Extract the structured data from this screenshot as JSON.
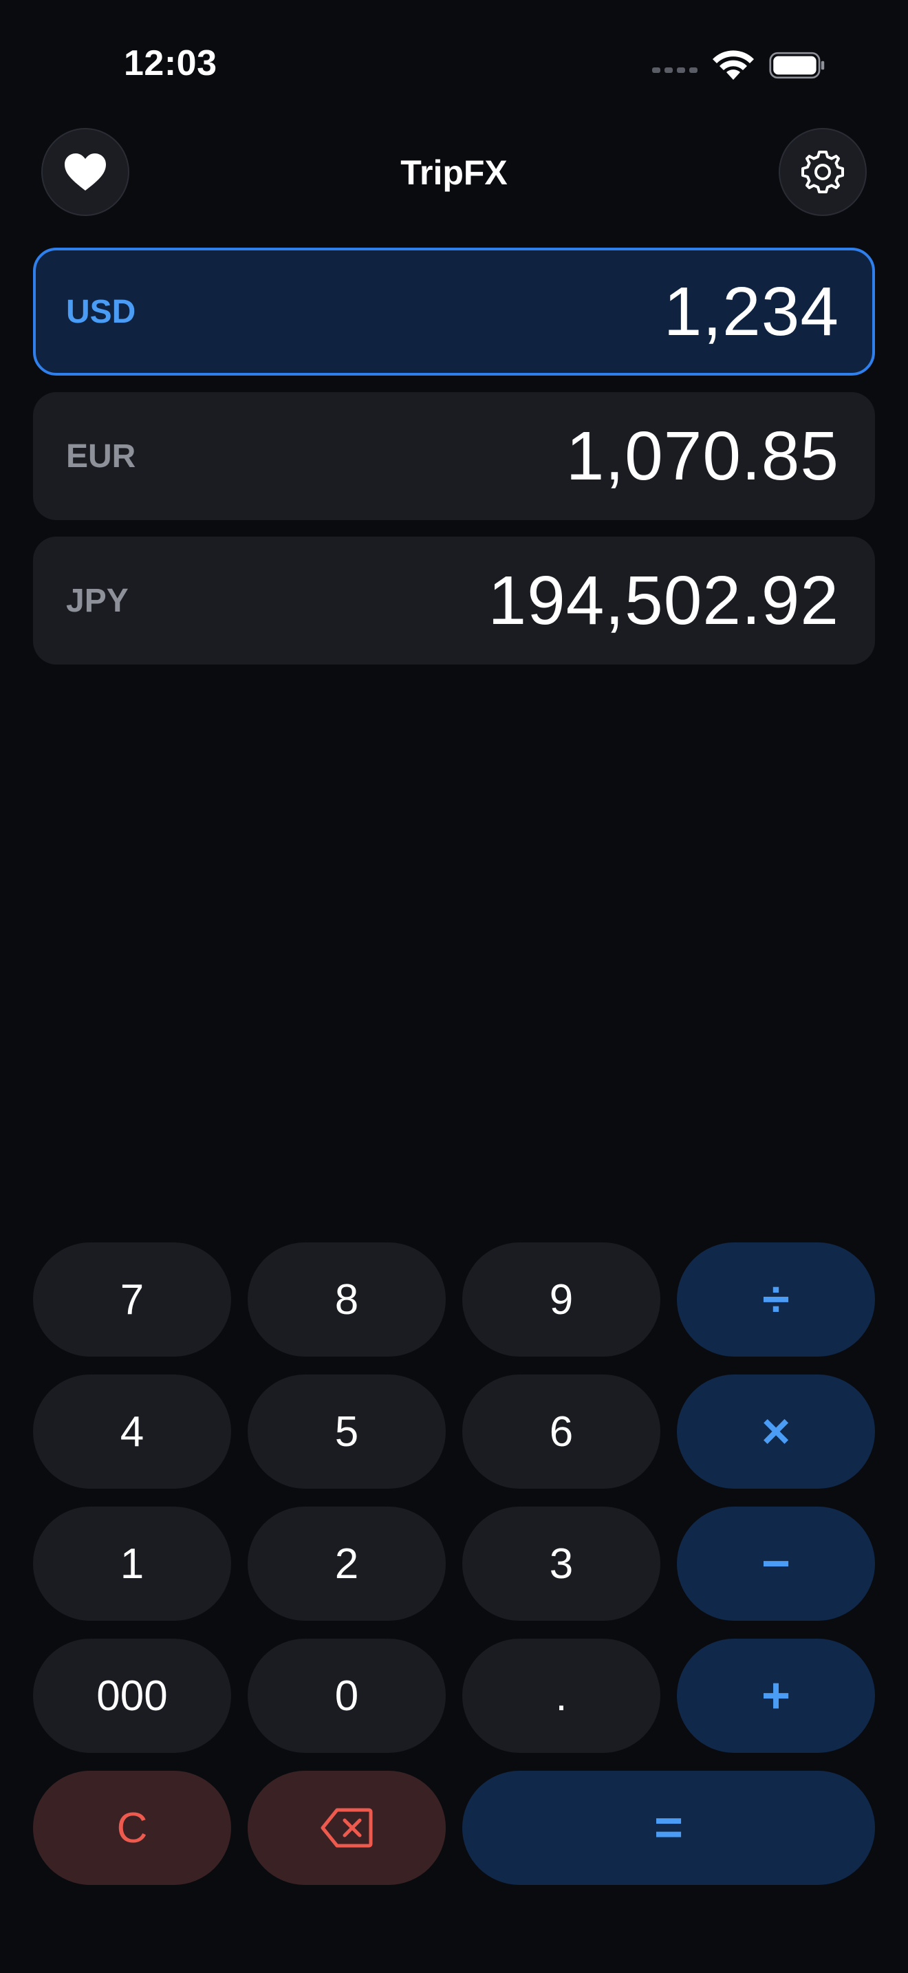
{
  "status_bar": {
    "time": "12:03",
    "icons": [
      "cellular-signal-icon",
      "wifi-icon",
      "battery-icon"
    ]
  },
  "header": {
    "title": "TripFX",
    "favorite_icon": "heart-icon",
    "settings_icon": "gear-icon"
  },
  "currencies": [
    {
      "code": "USD",
      "amount": "1,234",
      "active": true
    },
    {
      "code": "EUR",
      "amount": "1,070.85",
      "active": false
    },
    {
      "code": "JPY",
      "amount": "194,502.92",
      "active": false
    }
  ],
  "keypad": {
    "keys": {
      "k7": "7",
      "k8": "8",
      "k9": "9",
      "divide": "÷",
      "k4": "4",
      "k5": "5",
      "k6": "6",
      "multiply": "×",
      "k1": "1",
      "k2": "2",
      "k3": "3",
      "minus": "−",
      "k000": "000",
      "k0": "0",
      "dot": ".",
      "plus": "+",
      "clear": "C",
      "equals": "="
    },
    "backspace_icon": "backspace-icon"
  },
  "colors": {
    "background": "#0a0b0f",
    "accent": "#4a9cf5",
    "active_border": "#2f80ed",
    "active_row": "#0f2340",
    "destructive": "#ef5a4f"
  }
}
